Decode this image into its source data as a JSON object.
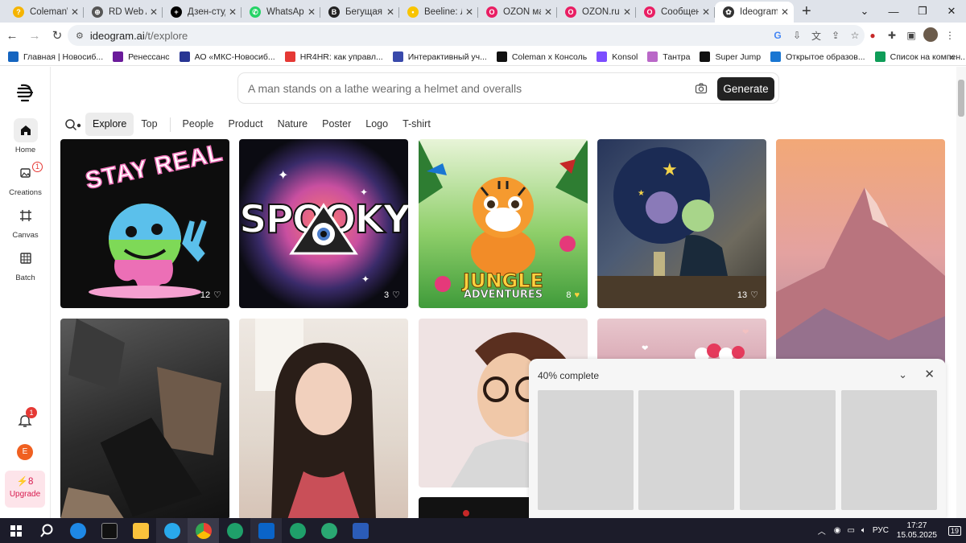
{
  "tabs": [
    {
      "title": "ColemanW",
      "color": "#f5b400",
      "glyph": "?"
    },
    {
      "title": "RD Web Ac",
      "color": "#555",
      "glyph": "⊕"
    },
    {
      "title": "Дзен-студи",
      "color": "#000",
      "glyph": "+"
    },
    {
      "title": "WhatsApp",
      "color": "#25d366",
      "glyph": "✆"
    },
    {
      "title": "Бегущая ст",
      "color": "#222",
      "glyph": "B"
    },
    {
      "title": "Beeline: Ли",
      "color": "#f8c400",
      "glyph": "•"
    },
    {
      "title": "OZON мар",
      "color": "#e91e63",
      "glyph": "O"
    },
    {
      "title": "OZON.ru -",
      "color": "#e91e63",
      "glyph": "O"
    },
    {
      "title": "Сообщени",
      "color": "#e91e63",
      "glyph": "O"
    },
    {
      "title": "Ideogram",
      "color": "#333",
      "glyph": "✿"
    }
  ],
  "new_tab_icon": "+",
  "address": {
    "domain": "ideogram.ai",
    "path": "/t/explore"
  },
  "bookmarks": [
    {
      "label": "Главная | Новосиб...",
      "color": "#1565c0"
    },
    {
      "label": "Ренессанс",
      "color": "#6a1b9a"
    },
    {
      "label": "АО «МКС-Новосиб...",
      "color": "#283593"
    },
    {
      "label": "HR4HR: как управл...",
      "color": "#e53935"
    },
    {
      "label": "Интерактивный уч...",
      "color": "#3949ab"
    },
    {
      "label": "Coleman x Консоль",
      "color": "#111"
    },
    {
      "label": "Konsol",
      "color": "#7c4dff"
    },
    {
      "label": "Тантра",
      "color": "#ba68c8"
    },
    {
      "label": "Super Jump",
      "color": "#111"
    },
    {
      "label": "Открытое образов...",
      "color": "#1976d2"
    },
    {
      "label": "Список на компен...",
      "color": "#0f9d58"
    }
  ],
  "sidebar": {
    "items": [
      {
        "label": "Home",
        "icon": "home-icon"
      },
      {
        "label": "Creations",
        "icon": "images-icon"
      },
      {
        "label": "Canvas",
        "icon": "canvas-icon"
      },
      {
        "label": "Batch",
        "icon": "batch-icon"
      }
    ],
    "creations_badge": "1",
    "notif_badge": "1",
    "avatar_letter": "E",
    "upgrade": {
      "count": "8",
      "label": "Upgrade"
    }
  },
  "prompt": {
    "text": "A man stands on a lathe wearing a helmet and overalls",
    "button": "Generate"
  },
  "filters": [
    "Explore",
    "Top",
    "People",
    "Product",
    "Nature",
    "Poster",
    "Logo",
    "T-shirt"
  ],
  "cards": [
    {
      "caption": "STAY REAL",
      "likes": "12"
    },
    {
      "caption": "SPOOKY",
      "likes": "3"
    },
    {
      "caption": "JUNGLE",
      "sub": "ADVENTURES",
      "likes": "8"
    },
    {
      "likes": "13"
    },
    {},
    {},
    {},
    {},
    {},
    {}
  ],
  "progress": {
    "label": "40% complete",
    "value": 0.4
  },
  "taskbar": {
    "lang": "РУС",
    "time": "17:27",
    "date": "15.05.2025",
    "notif": "19"
  }
}
